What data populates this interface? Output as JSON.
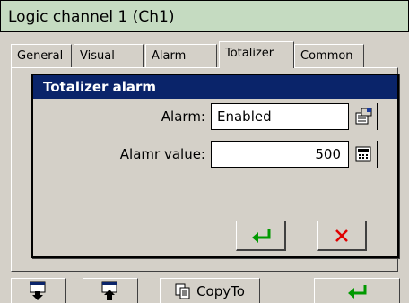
{
  "window": {
    "title": "Logic channel 1 (Ch1)"
  },
  "tabs": [
    {
      "label": "General"
    },
    {
      "label": "Visual"
    },
    {
      "label": "Alarm"
    },
    {
      "label": "Totalizer",
      "active": true
    },
    {
      "label": "Common"
    }
  ],
  "dialog": {
    "title": "Totalizer alarm",
    "fields": [
      {
        "label": "Alarm:",
        "value": "Enabled",
        "button_icon": "dropdown-list-icon"
      },
      {
        "label": "Alamr value:",
        "value": "500",
        "button_icon": "calculator-icon"
      }
    ],
    "ok_icon": "enter-arrow-icon",
    "cancel_icon": "close-x-icon"
  },
  "toolbar": {
    "copy_label": "CopyTo",
    "buttons": [
      "move-down-icon",
      "move-up-icon",
      "copy-icon",
      "enter-arrow-icon"
    ]
  },
  "colors": {
    "title_bar": "#c5dbc1",
    "dialog_title": "#0a246a",
    "background": "#d4d0c8",
    "ok_green": "#009900",
    "cancel_red": "#e00000"
  }
}
